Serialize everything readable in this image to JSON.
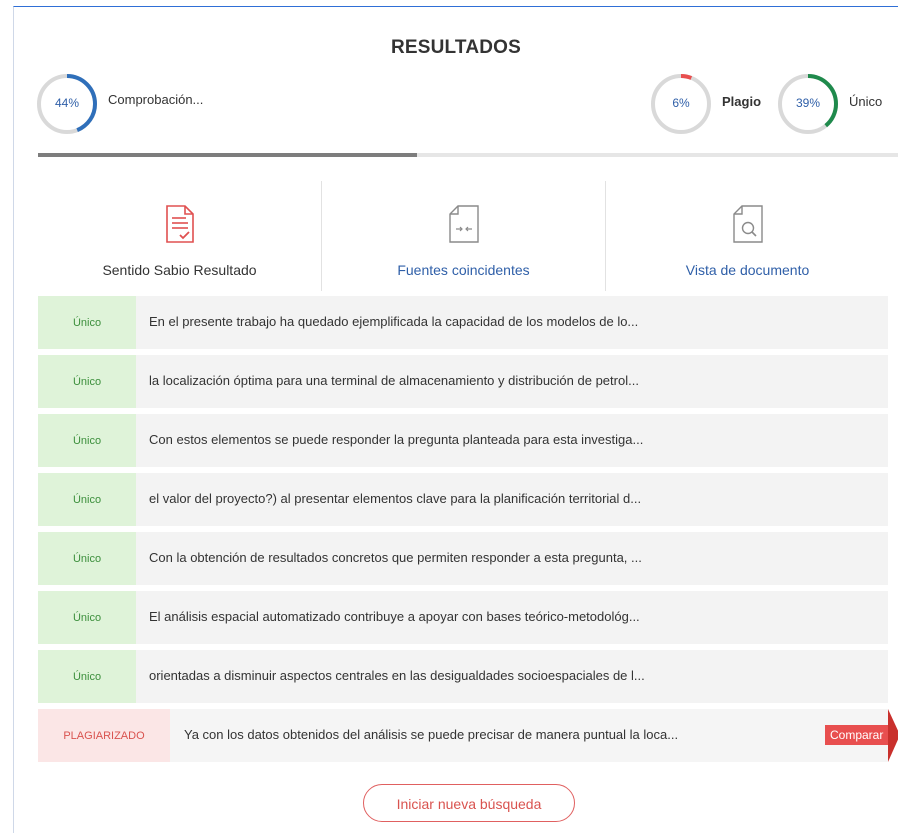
{
  "header": {
    "title": "RESULTADOS"
  },
  "stats": {
    "check": {
      "percent_text": "44%",
      "value": 44,
      "label": "Comprobación...",
      "color": "#2f6fba"
    },
    "plagio": {
      "percent_text": "6%",
      "value": 6,
      "label": "Plagio",
      "color": "#e84f4f"
    },
    "unico": {
      "percent_text": "39%",
      "value": 39,
      "label": "Único",
      "color": "#1f8a4c"
    }
  },
  "progress": {
    "value": 0.44
  },
  "tabs": [
    {
      "label": "Sentido Sabio Resultado",
      "icon": "report-icon"
    },
    {
      "label": "Fuentes coincidentes",
      "icon": "compare-document-icon"
    },
    {
      "label": "Vista de documento",
      "icon": "search-document-icon"
    }
  ],
  "results": [
    {
      "status": "Único",
      "text": "En el presente trabajo ha quedado ejemplificada la capacidad de los modelos de lo..."
    },
    {
      "status": "Único",
      "text": "la localización óptima para una terminal de almacenamiento y distribución de petrol..."
    },
    {
      "status": "Único",
      "text": "Con estos elementos se puede responder la pregunta planteada para esta investiga..."
    },
    {
      "status": "Único",
      "text": "el valor del proyecto?) al presentar elementos clave para la planificación territorial d..."
    },
    {
      "status": "Único",
      "text": "Con la obtención de resultados concretos que permiten responder a esta pregunta, ..."
    },
    {
      "status": "Único",
      "text": "El análisis espacial automatizado contribuye a apoyar con bases teórico-metodológ..."
    },
    {
      "status": "Único",
      "text": "orientadas a disminuir aspectos centrales en las desigualdades socioespaciales de l..."
    }
  ],
  "plag_row": {
    "status": "PLAGIARIZADO",
    "text": "Ya con los datos obtenidos del análisis se puede precisar de manera puntual la loca...",
    "compare_label": "Comparar"
  },
  "new_search_label": "Iniciar nueva búsqueda"
}
